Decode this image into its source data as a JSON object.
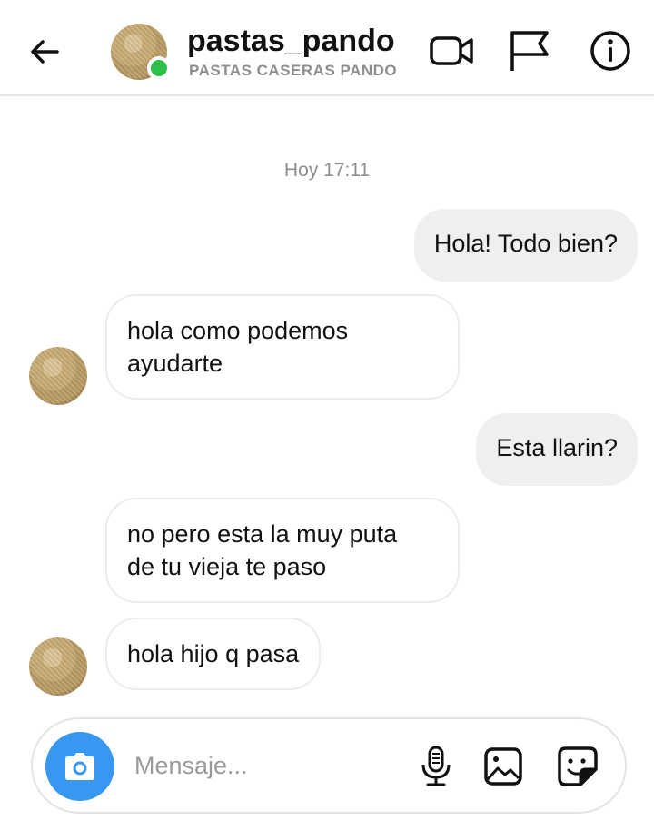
{
  "header": {
    "username": "pastas_pando",
    "full_name": "PASTAS CASERAS PANDO",
    "online": true,
    "icons": [
      "back-arrow-icon",
      "video-call-icon",
      "flag-icon",
      "info-icon"
    ]
  },
  "conversation": {
    "timestamp": "Hoy 17:11",
    "messages": [
      {
        "direction": "outgoing",
        "text": "Hola! Todo bien?"
      },
      {
        "direction": "incoming",
        "line1": "hola como podemos",
        "line2": "ayudarte"
      },
      {
        "direction": "outgoing",
        "text": "Esta llarin?"
      },
      {
        "direction": "incoming",
        "line1": "no pero esta la muy puta",
        "line2": "de tu vieja te paso"
      },
      {
        "direction": "incoming",
        "text": "hola hijo q pasa"
      }
    ]
  },
  "composer": {
    "placeholder": "Mensaje...",
    "icons": [
      "camera-icon",
      "microphone-icon",
      "gallery-icon",
      "sticker-icon"
    ]
  },
  "colors": {
    "accent": "#3897f0",
    "online": "#2fbf4d",
    "outgoing_bubble": "#efefef",
    "secondary_text": "#8e8e8e"
  }
}
